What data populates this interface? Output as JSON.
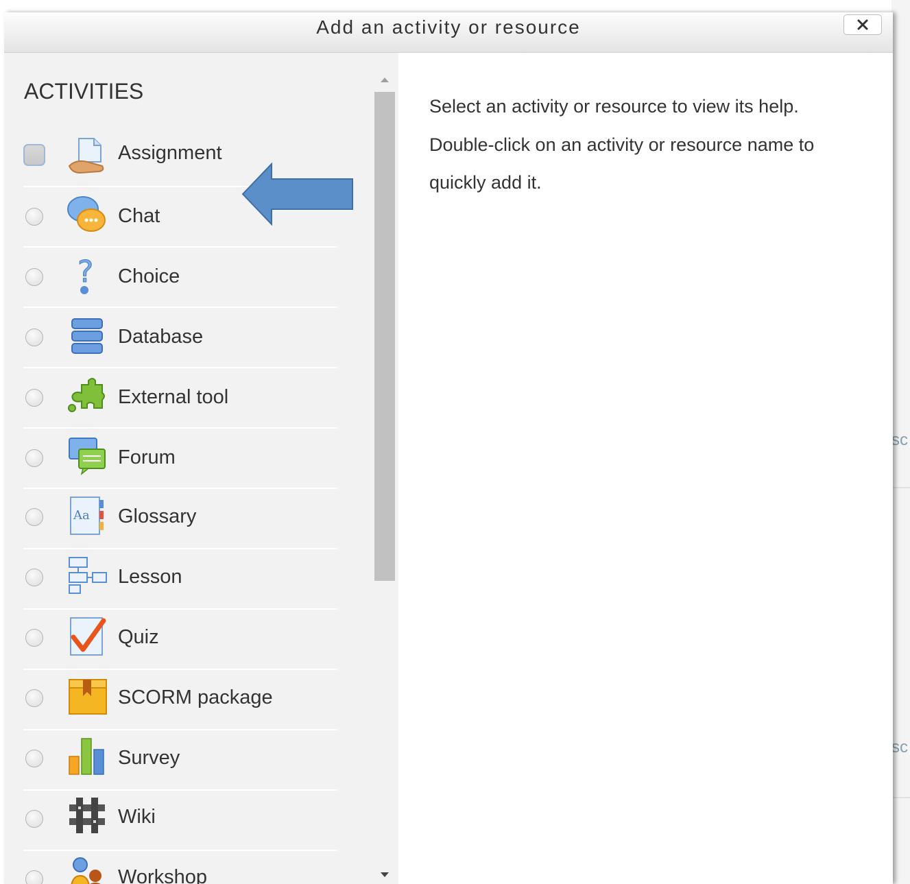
{
  "dialog": {
    "title": "Add an activity or resource",
    "close_icon": "close-x-icon"
  },
  "activities": {
    "section_title": "ACTIVITIES",
    "items": [
      {
        "label": "Assignment",
        "icon": "assignment-icon",
        "selected": true
      },
      {
        "label": "Chat",
        "icon": "chat-icon",
        "selected": false
      },
      {
        "label": "Choice",
        "icon": "choice-icon",
        "selected": false
      },
      {
        "label": "Database",
        "icon": "database-icon",
        "selected": false
      },
      {
        "label": "External tool",
        "icon": "external-tool-icon",
        "selected": false
      },
      {
        "label": "Forum",
        "icon": "forum-icon",
        "selected": false
      },
      {
        "label": "Glossary",
        "icon": "glossary-icon",
        "selected": false
      },
      {
        "label": "Lesson",
        "icon": "lesson-icon",
        "selected": false
      },
      {
        "label": "Quiz",
        "icon": "quiz-icon",
        "selected": false
      },
      {
        "label": "SCORM package",
        "icon": "scorm-package-icon",
        "selected": false
      },
      {
        "label": "Survey",
        "icon": "survey-icon",
        "selected": false
      },
      {
        "label": "Wiki",
        "icon": "wiki-icon",
        "selected": false
      },
      {
        "label": "Workshop",
        "icon": "workshop-icon",
        "selected": false
      }
    ]
  },
  "help": {
    "line1": "Select an activity or resource to view its help.",
    "line2": "Double-click on an activity or resource name to",
    "line3": "quickly add it."
  },
  "background": {
    "text_a": "sc",
    "text_b": "sc"
  },
  "colors": {
    "annotation_arrow": "#5b8fc9",
    "panel_bg": "#f2f2f2",
    "text": "#333333"
  }
}
